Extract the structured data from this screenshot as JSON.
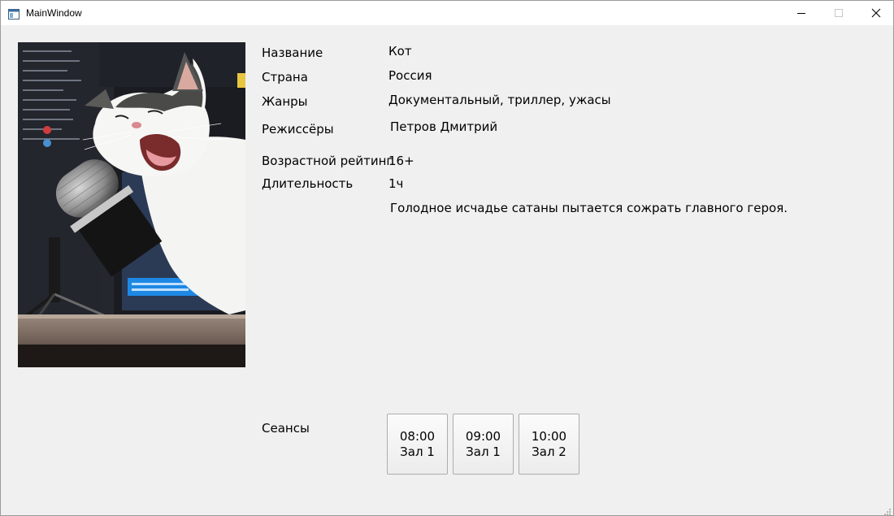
{
  "window": {
    "title": "MainWindow",
    "controls": {
      "minimize_icon": "minimize-icon",
      "maximize_icon": "maximize-icon",
      "close_icon": "close-icon"
    }
  },
  "movie": {
    "poster_icon": "cat-microphone-photo",
    "fields": {
      "title": {
        "label": "Название",
        "value": "Кот"
      },
      "country": {
        "label": "Страна",
        "value": "Россия"
      },
      "genres": {
        "label": "Жанры",
        "value": "Документальный, триллер, ужасы"
      },
      "directors": {
        "label": "Режиссёры",
        "value": "Петров Дмитрий"
      },
      "age_rating": {
        "label": "Возрастной рейтинг",
        "value": "16+"
      },
      "duration": {
        "label": "Длительность",
        "value": "1ч"
      }
    },
    "description": "Голодное исчадье сатаны пытается сожрать главного героя."
  },
  "sessions": {
    "label": "Сеансы",
    "items": [
      {
        "time": "08:00",
        "hall": "Зал 1"
      },
      {
        "time": "09:00",
        "hall": "Зал 1"
      },
      {
        "time": "10:00",
        "hall": "Зал 2"
      }
    ]
  },
  "colors": {
    "window_bg": "#f0f0f0",
    "titlebar_bg": "#ffffff",
    "button_border": "#adadad"
  }
}
